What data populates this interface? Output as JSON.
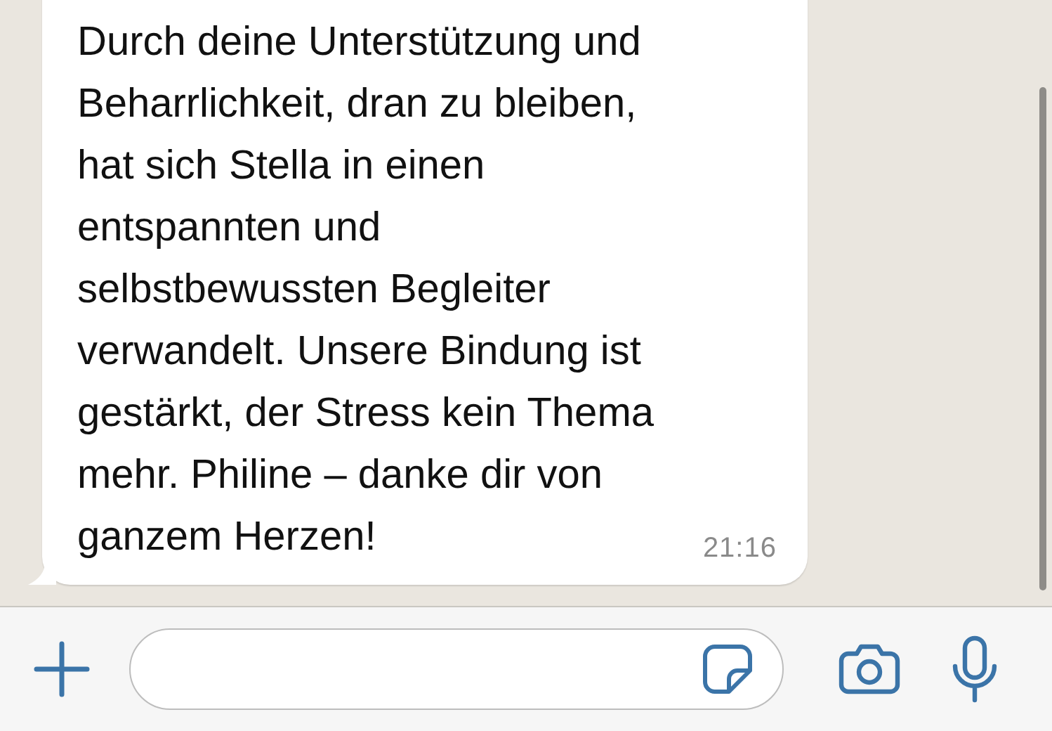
{
  "message": {
    "text": "Durch deine Unterstützung und\nBeharrlichkeit, dran zu bleiben,\nhat sich Stella in einen\nentspannten und\nselbstbewussten Begleiter\nverwandelt. Unsere Bindung ist\ngestärkt, der Stress kein Thema\nmehr. Philine – danke dir von\nganzem Herzen!",
    "time": "21:16"
  }
}
